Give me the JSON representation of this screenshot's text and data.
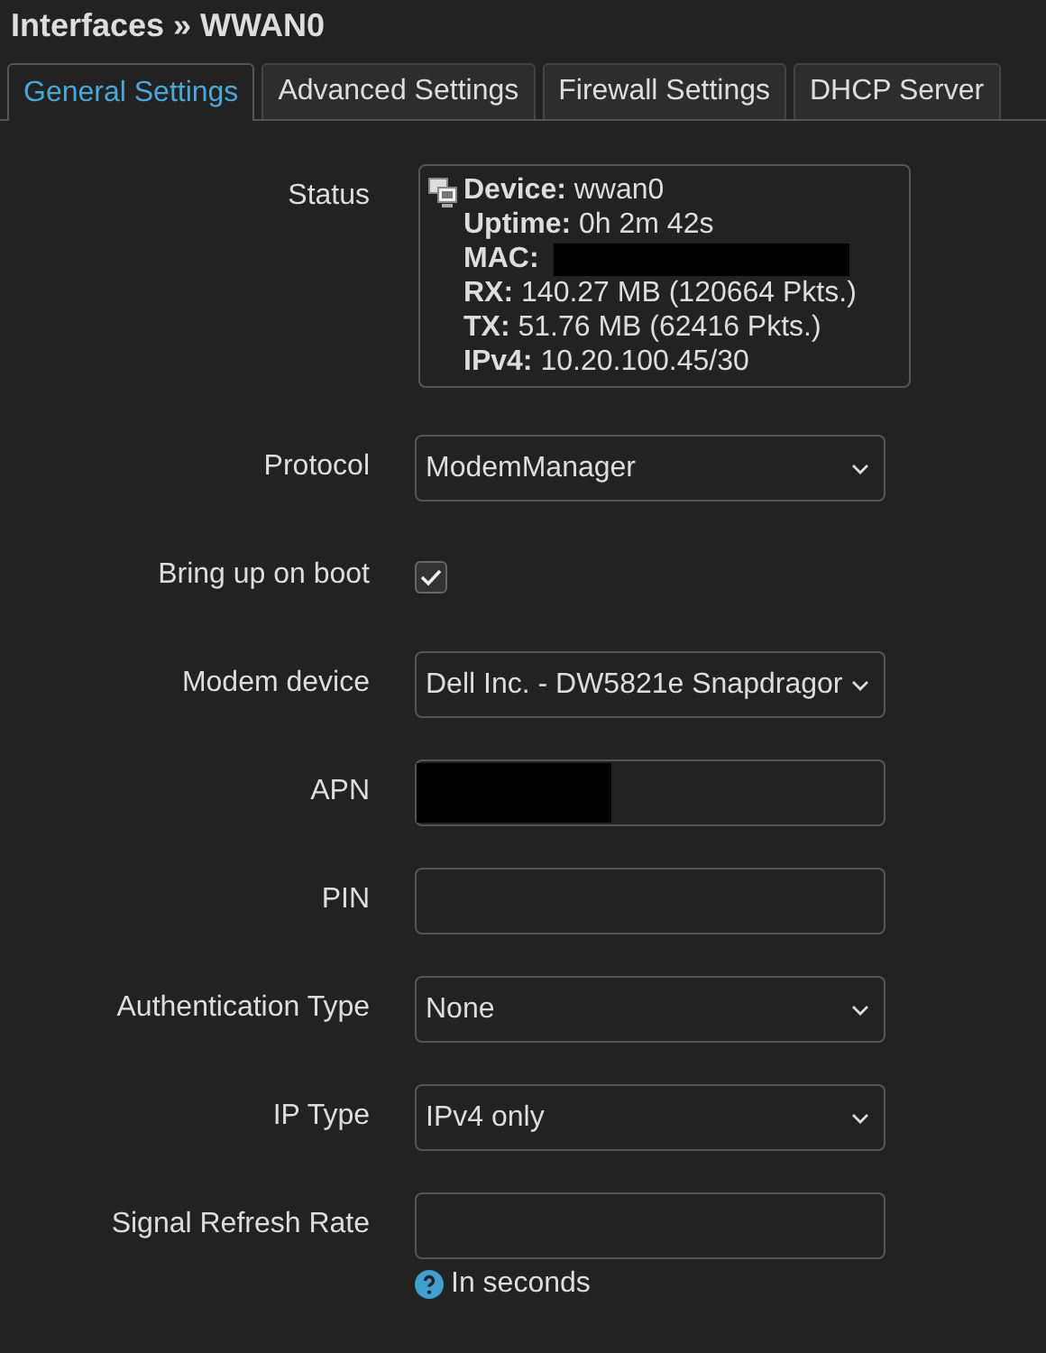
{
  "title": "Interfaces » WWAN0",
  "tabs": [
    {
      "label": "General Settings",
      "selected": true
    },
    {
      "label": "Advanced Settings",
      "selected": false
    },
    {
      "label": "Firewall Settings",
      "selected": false
    },
    {
      "label": "DHCP Server",
      "selected": false
    }
  ],
  "status": {
    "label": "Status",
    "lines": [
      {
        "key": "Device:",
        "value": "wwan0",
        "redacted": false
      },
      {
        "key": "Uptime:",
        "value": "0h 2m 42s",
        "redacted": false
      },
      {
        "key": "MAC:",
        "redacted": true
      },
      {
        "key": "RX:",
        "value": "140.27 MB (120664 Pkts.)",
        "redacted": false
      },
      {
        "key": "TX:",
        "value": "51.76 MB (62416 Pkts.)",
        "redacted": false
      },
      {
        "key": "IPv4:",
        "value": "10.20.100.45/30",
        "redacted": false
      }
    ]
  },
  "fields": [
    {
      "kind": "select",
      "label": "Protocol",
      "value": "ModemManager"
    },
    {
      "kind": "checkbox",
      "label": "Bring up on boot",
      "checked": true
    },
    {
      "kind": "select",
      "label": "Modem device",
      "value": "Dell Inc. - DW5821e Snapdragor"
    },
    {
      "kind": "text",
      "label": "APN",
      "redacted": true
    },
    {
      "kind": "text",
      "label": "PIN",
      "redacted": false
    },
    {
      "kind": "select",
      "label": "Authentication Type",
      "value": "None"
    },
    {
      "kind": "select",
      "label": "IP Type",
      "value": "IPv4 only"
    },
    {
      "kind": "text",
      "label": "Signal Refresh Rate",
      "redacted": false,
      "hint": "In seconds"
    }
  ]
}
